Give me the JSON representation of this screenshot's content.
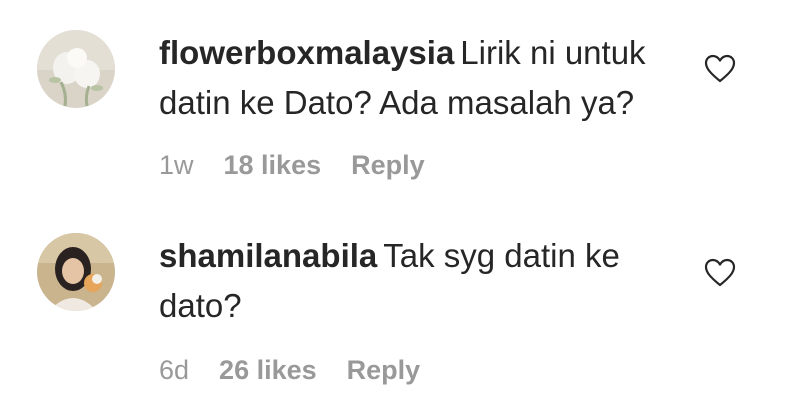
{
  "comments": [
    {
      "username": "flowerboxmalaysia",
      "text": "Lirik ni untuk datin ke Dato? Ada masalah ya?",
      "time": "1w",
      "likes": "18 likes",
      "reply_label": "Reply",
      "avatar_icon": "flower-avatar-icon"
    },
    {
      "username": "shamilanabila",
      "text": "Tak syg datin ke dato?",
      "time": "6d",
      "likes": "26 likes",
      "reply_label": "Reply",
      "avatar_icon": "person-avatar-icon"
    }
  ],
  "like_icon": "heart-outline-icon",
  "colors": {
    "text_primary": "#262626",
    "text_secondary": "#999999",
    "background": "#ffffff"
  }
}
